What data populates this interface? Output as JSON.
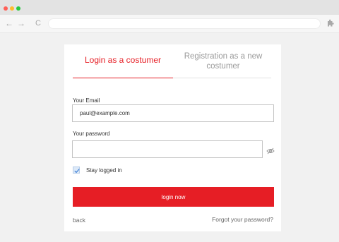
{
  "browser": {
    "back_icon": "←",
    "forward_icon": "→",
    "reload_icon": "C",
    "extension_icon": "puzzle-icon"
  },
  "tabs": {
    "login_label": "Login as a costumer",
    "register_label": "Registration as a new costumer",
    "active": "login"
  },
  "form": {
    "email_label": "Your Email",
    "email_value": "paul@example.com",
    "password_label": "Your password",
    "password_value": "",
    "stay_logged_label": "Stay logged in",
    "stay_logged_checked": true,
    "submit_label": "login now"
  },
  "footer": {
    "back_label": "back",
    "forgot_label": "Forgot your password?"
  },
  "colors": {
    "accent": "#e61e25",
    "checkbox_fill": "#dce9f8"
  }
}
